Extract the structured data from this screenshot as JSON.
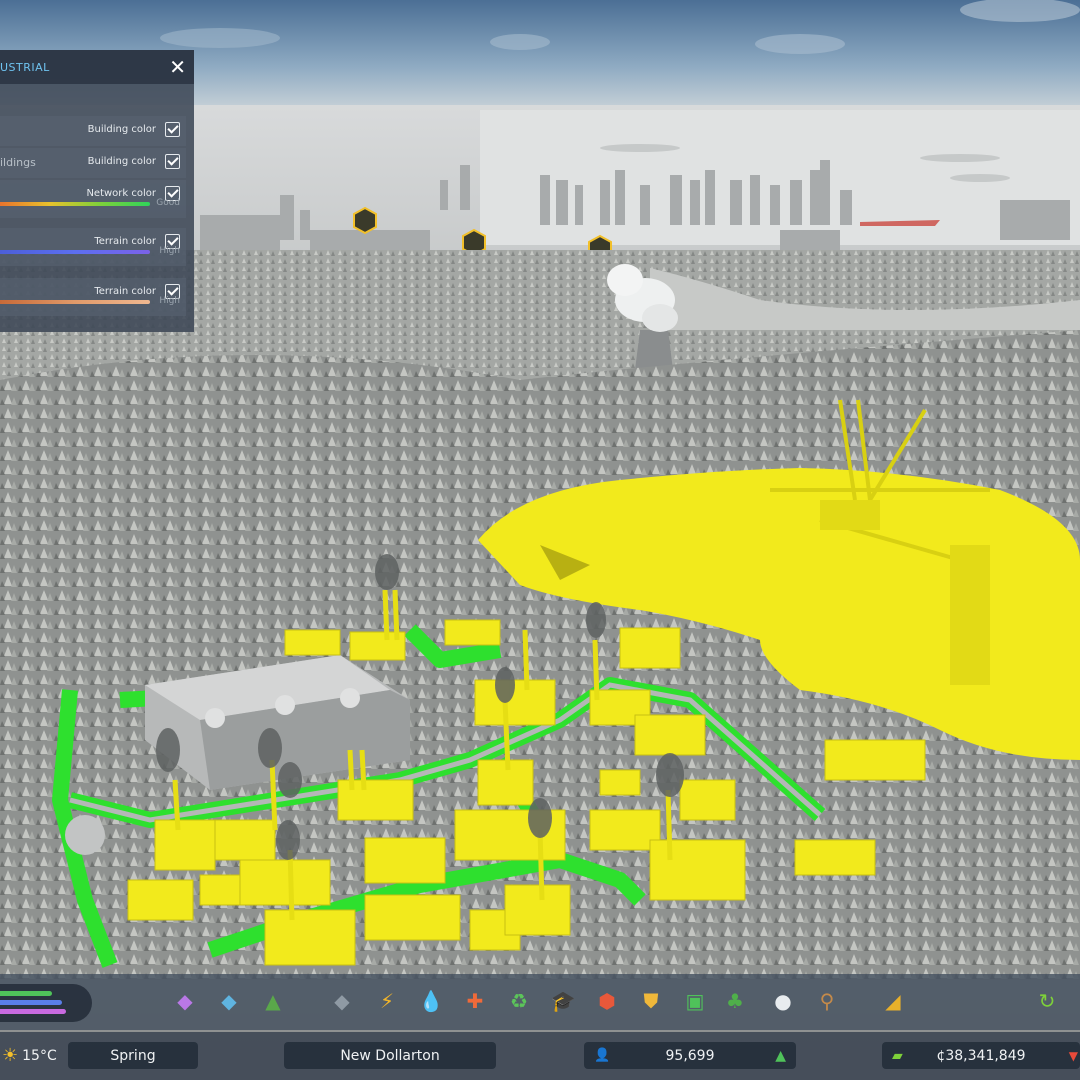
{
  "info_panel": {
    "title": "USTRIAL",
    "close_icon": "close-icon",
    "rows": [
      {
        "label": "",
        "option": "Building color",
        "checked": true,
        "gradient_end": "",
        "gradient": ""
      },
      {
        "label": "ildings",
        "option": "Building color",
        "checked": true,
        "gradient_end": "",
        "gradient": ""
      },
      {
        "label": "",
        "option": "Network color",
        "checked": true,
        "gradient_end": "Good",
        "gradient": "linear-gradient(90deg,#e8732c,#e8c22c,#7ed13a,#2fd35a)"
      },
      {
        "label": "",
        "option": "Terrain color",
        "checked": true,
        "gradient_end": "High",
        "gradient": "linear-gradient(90deg,#4c5fd8,#5c6ff0,#7b62e8)"
      },
      {
        "label": "",
        "option": "Terrain color",
        "checked": true,
        "gradient_end": "High",
        "gradient": "linear-gradient(90deg,#c86a38,#e09a6a,#f0b890)"
      }
    ]
  },
  "toolbar": {
    "tools": [
      {
        "name": "zoning-icon",
        "glyph": "◆",
        "color": "#b978e6"
      },
      {
        "name": "area-icon",
        "glyph": "◆",
        "color": "#5fb4e0"
      },
      {
        "name": "terrain-icon",
        "glyph": "▲",
        "color": "#5aa84a"
      },
      {
        "name": "roads-icon",
        "glyph": "◆",
        "color": "#8f9aa4"
      },
      {
        "name": "electricity-icon",
        "glyph": "⚡",
        "color": "#f2b52a"
      },
      {
        "name": "water-icon",
        "glyph": "💧",
        "color": "#4fa8ef"
      },
      {
        "name": "health-icon",
        "glyph": "✚",
        "color": "#ef6a3a"
      },
      {
        "name": "garbage-icon",
        "glyph": "♻",
        "color": "#5cc45a"
      },
      {
        "name": "education-icon",
        "glyph": "🎓",
        "color": "#6a8fb8"
      },
      {
        "name": "fire-icon",
        "glyph": "⬢",
        "color": "#e8583a"
      },
      {
        "name": "police-icon",
        "glyph": "⛊",
        "color": "#f0b83a"
      },
      {
        "name": "transport-icon",
        "glyph": "▣",
        "color": "#4fc25a"
      },
      {
        "name": "parks-icon",
        "glyph": "♣",
        "color": "#4fb04a"
      },
      {
        "name": "communications-icon",
        "glyph": "●",
        "color": "#e8ecef"
      },
      {
        "name": "landscaping-icon",
        "glyph": "⚲",
        "color": "#c48a4a"
      },
      {
        "name": "bulldozer-icon",
        "glyph": "◢",
        "color": "#e8b02a"
      },
      {
        "name": "undo-icon",
        "glyph": "↻",
        "color": "#7ed13a"
      }
    ],
    "progress_bars": [
      {
        "color": "#4fc25a",
        "fill": 0.65
      },
      {
        "color": "#5a7ee8",
        "fill": 0.78
      },
      {
        "color": "#c86ae0",
        "fill": 0.82
      }
    ]
  },
  "status": {
    "temperature": "15°C",
    "weather_icon": "sun-icon",
    "season": "Spring",
    "city_name": "New Dollarton",
    "population_icon": "person-icon",
    "population": "95,699",
    "happiness_icon": "tree-icon",
    "money_icon": "money-icon",
    "money": "¢38,341,849",
    "trend_icon": "down-arrow-icon"
  },
  "colors": {
    "industrial_highlight": "#f2ea1c",
    "road_highlight": "#2ee02e",
    "panel_accent": "#6fc3f0"
  }
}
